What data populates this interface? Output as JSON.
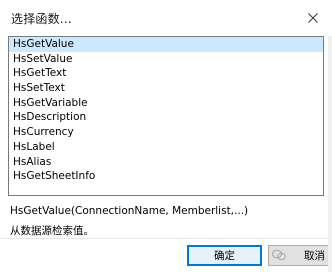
{
  "dialog": {
    "title": "选择函数...",
    "close_label": "close"
  },
  "functions": {
    "selected": "HsGetValue",
    "items": [
      {
        "label": "HsGetValue"
      },
      {
        "label": "HsSetValue"
      },
      {
        "label": "HsGetText"
      },
      {
        "label": "HsSetText"
      },
      {
        "label": "HsGetVariable"
      },
      {
        "label": "HsDescription"
      },
      {
        "label": "HsCurrency"
      },
      {
        "label": "HsLabel"
      },
      {
        "label": "HsAlias"
      },
      {
        "label": "HsGetSheetInfo"
      }
    ]
  },
  "details": {
    "signature": "HsGetValue(ConnectionName, Memberlist,...)",
    "description": "从数据源检索值。"
  },
  "buttons": {
    "ok_label": "确定",
    "cancel_label": "取消"
  },
  "icons": {
    "close": "close-icon",
    "watermark": "wechat-logo-icon"
  },
  "colors": {
    "selection": "#cce8ff",
    "ok_border": "#0078d7"
  }
}
